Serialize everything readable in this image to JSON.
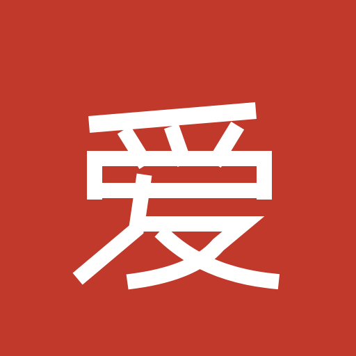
{
  "icon": {
    "character": "爱",
    "background_color": "#C0392B",
    "glyph_color": "#FFFFFF"
  }
}
